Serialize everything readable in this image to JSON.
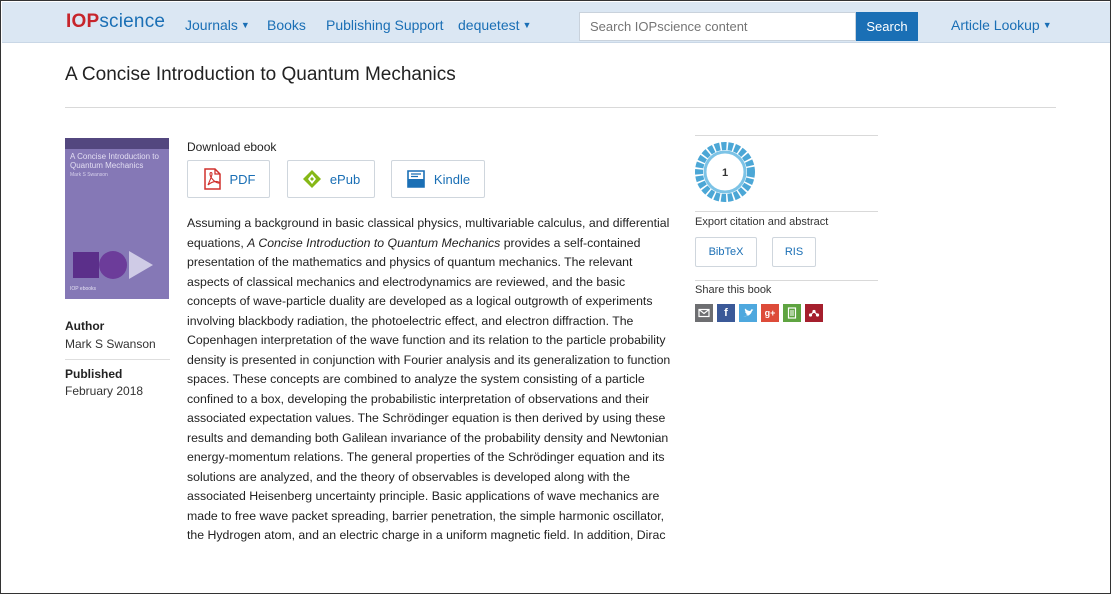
{
  "nav": {
    "logo_iop": "IOP",
    "logo_science": "science",
    "journals": "Journals",
    "books": "Books",
    "publishing_support": "Publishing Support",
    "account": "dequetest",
    "search_placeholder": "Search IOPscience content",
    "search_button": "Search",
    "article_lookup": "Article Lookup"
  },
  "page": {
    "title": "A Concise Introduction to Quantum Mechanics"
  },
  "cover": {
    "title": "A Concise Introduction to Quantum Mechanics",
    "author": "Mark S Swanson",
    "footer": "IOP ebooks",
    "colors": {
      "background": "#8578b6",
      "shapes": "#5b2f8a"
    }
  },
  "meta": {
    "author_label": "Author",
    "author_value": "Mark S Swanson",
    "published_label": "Published",
    "published_value": "February 2018"
  },
  "download": {
    "label": "Download ebook",
    "pdf": "PDF",
    "epub": "ePub",
    "kindle": "Kindle"
  },
  "description": {
    "part1": "Assuming a background in basic classical physics, multivariable calculus, and differential equations, ",
    "book_title": "A Concise Introduction to Quantum Mechanics",
    "part2": " provides a self-contained presentation of the mathematics and physics of quantum mechanics. The relevant aspects of classical mechanics and electrodynamics are reviewed, and the basic concepts of wave-particle duality are developed as a logical outgrowth of experiments involving blackbody radiation, the photoelectric effect, and electron diffraction. The Copenhagen interpretation of the wave function and its relation to the particle probability density is presented in conjunction with Fourier analysis and its generalization to function spaces. These concepts are combined to analyze the system consisting of a particle confined to a box, developing the probabilistic interpretation of observations and their associated expectation values. The Schrödinger equation is then derived by using these results and demanding both Galilean invariance of the probability density and Newtonian energy-momentum relations. The general properties of the Schrödinger equation and its solutions are analyzed, and the theory of observables is developed along with the associated Heisenberg uncertainty principle. Basic applications of wave mechanics are made to free wave packet spreading, barrier penetration, the simple harmonic oscillator, the Hydrogen atom, and an electric charge in a uniform magnetic field. In addition, Dirac"
  },
  "metrics": {
    "badge_value": "1"
  },
  "export": {
    "label": "Export citation and abstract",
    "bibtex": "BibTeX",
    "ris": "RIS"
  },
  "share": {
    "label": "Share this book",
    "icons": [
      "email-icon",
      "facebook-icon",
      "twitter-icon",
      "google-plus-icon",
      "evernote-icon",
      "mendeley-icon"
    ]
  },
  "colors": {
    "navbar": "#dbe7f3",
    "link": "#1a6fb5",
    "search_button": "#1a6fb5",
    "logo_red": "#c7252b"
  }
}
